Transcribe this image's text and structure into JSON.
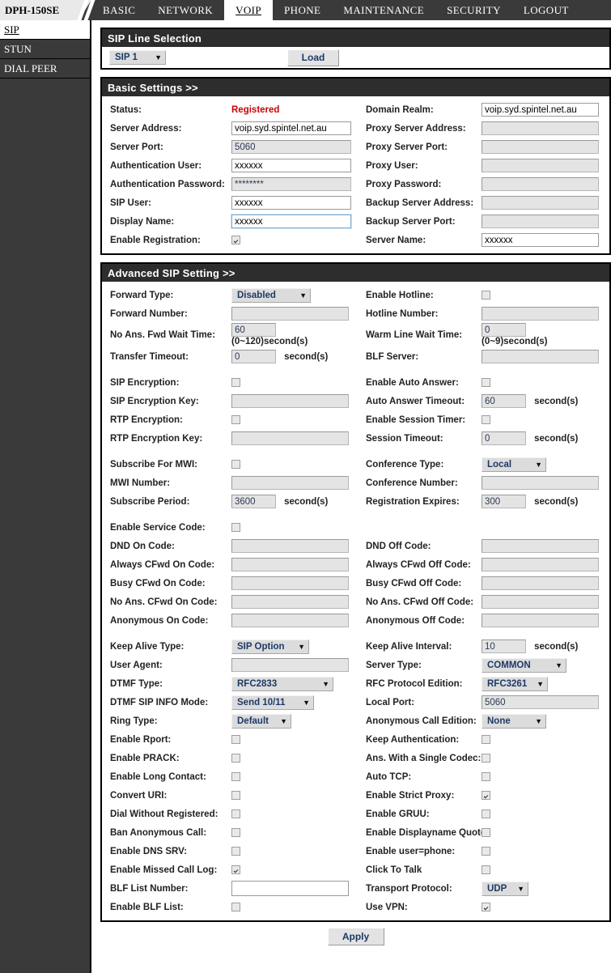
{
  "device": {
    "model": "DPH-150SE"
  },
  "nav": {
    "tabs": [
      {
        "label": "BASIC",
        "active": false
      },
      {
        "label": "NETWORK",
        "active": false
      },
      {
        "label": "VOIP",
        "active": true
      },
      {
        "label": "PHONE",
        "active": false
      },
      {
        "label": "MAINTENANCE",
        "active": false
      },
      {
        "label": "SECURITY",
        "active": false
      },
      {
        "label": "LOGOUT",
        "active": false
      }
    ]
  },
  "sidebar": {
    "items": [
      {
        "label": "SIP",
        "active": true
      },
      {
        "label": "STUN",
        "active": false
      },
      {
        "label": "DIAL PEER",
        "active": false
      }
    ]
  },
  "line_selection": {
    "title": "SIP Line Selection",
    "line_value": "SIP 1",
    "load_label": "Load"
  },
  "basic": {
    "title": "Basic Settings >>",
    "status_label": "Status:",
    "status_value": "Registered",
    "status_color": "#cc0000",
    "domain_realm_label": "Domain Realm:",
    "domain_realm_value": "voip.syd.spintel.net.au",
    "server_address_label": "Server Address:",
    "server_address_value": "voip.syd.spintel.net.au",
    "proxy_server_address_label": "Proxy Server Address:",
    "proxy_server_address_value": "",
    "server_port_label": "Server Port:",
    "server_port_value": "5060",
    "proxy_server_port_label": "Proxy Server Port:",
    "proxy_server_port_value": "",
    "auth_user_label": "Authentication User:",
    "auth_user_value": "xxxxxx",
    "proxy_user_label": "Proxy User:",
    "proxy_user_value": "",
    "auth_password_label": "Authentication Password:",
    "auth_password_value": "********",
    "proxy_password_label": "Proxy Password:",
    "proxy_password_value": "",
    "sip_user_label": "SIP User:",
    "sip_user_value": "xxxxxx",
    "backup_server_address_label": "Backup Server Address:",
    "backup_server_address_value": "",
    "display_name_label": "Display Name:",
    "display_name_value": "xxxxxx",
    "backup_server_port_label": "Backup Server Port:",
    "backup_server_port_value": "",
    "enable_registration_label": "Enable Registration:",
    "enable_registration_checked": true,
    "server_name_label": "Server Name:",
    "server_name_value": "xxxxxx"
  },
  "advanced": {
    "title": "Advanced SIP Setting >>",
    "forward_type_label": "Forward Type:",
    "forward_type_value": "Disabled",
    "enable_hotline_label": "Enable Hotline:",
    "enable_hotline_checked": false,
    "forward_number_label": "Forward Number:",
    "forward_number_value": "",
    "hotline_number_label": "Hotline Number:",
    "hotline_number_value": "",
    "no_ans_fwd_wait_label": "No Ans. Fwd Wait Time:",
    "no_ans_fwd_wait_value": "60",
    "no_ans_fwd_wait_hint": "(0~120)second(s)",
    "warm_line_wait_label": "Warm Line Wait Time:",
    "warm_line_wait_value": "0",
    "warm_line_wait_hint": "(0~9)second(s)",
    "transfer_timeout_label": "Transfer Timeout:",
    "transfer_timeout_value": "0",
    "transfer_timeout_unit": "second(s)",
    "blf_server_label": "BLF Server:",
    "blf_server_value": "",
    "sip_encryption_label": "SIP Encryption:",
    "sip_encryption_checked": false,
    "enable_auto_answer_label": "Enable Auto Answer:",
    "enable_auto_answer_checked": false,
    "sip_encryption_key_label": "SIP Encryption Key:",
    "sip_encryption_key_value": "",
    "auto_answer_timeout_label": "Auto Answer Timeout:",
    "auto_answer_timeout_value": "60",
    "auto_answer_timeout_unit": "second(s)",
    "rtp_encryption_label": "RTP Encryption:",
    "rtp_encryption_checked": false,
    "enable_session_timer_label": "Enable Session Timer:",
    "enable_session_timer_checked": false,
    "rtp_encryption_key_label": "RTP Encryption Key:",
    "rtp_encryption_key_value": "",
    "session_timeout_label": "Session Timeout:",
    "session_timeout_value": "0",
    "session_timeout_unit": "second(s)",
    "subscribe_mwi_label": "Subscribe For MWI:",
    "subscribe_mwi_checked": false,
    "conference_type_label": "Conference Type:",
    "conference_type_value": "Local",
    "mwi_number_label": "MWI Number:",
    "mwi_number_value": "",
    "conference_number_label": "Conference Number:",
    "conference_number_value": "",
    "subscribe_period_label": "Subscribe Period:",
    "subscribe_period_value": "3600",
    "subscribe_period_unit": "second(s)",
    "registration_expires_label": "Registration Expires:",
    "registration_expires_value": "300",
    "registration_expires_unit": "second(s)",
    "enable_service_code_label": "Enable Service Code:",
    "enable_service_code_checked": false,
    "dnd_on_label": "DND On Code:",
    "dnd_on_value": "",
    "dnd_off_label": "DND Off Code:",
    "dnd_off_value": "",
    "always_cfwd_on_label": "Always CFwd On Code:",
    "always_cfwd_on_value": "",
    "always_cfwd_off_label": "Always CFwd Off Code:",
    "always_cfwd_off_value": "",
    "busy_cfwd_on_label": "Busy CFwd On Code:",
    "busy_cfwd_on_value": "",
    "busy_cfwd_off_label": "Busy CFwd Off Code:",
    "busy_cfwd_off_value": "",
    "noans_cfwd_on_label": "No Ans. CFwd On Code:",
    "noans_cfwd_on_value": "",
    "noans_cfwd_off_label": "No Ans. CFwd Off Code:",
    "noans_cfwd_off_value": "",
    "anonymous_on_label": "Anonymous On Code:",
    "anonymous_on_value": "",
    "anonymous_off_label": "Anonymous Off Code:",
    "anonymous_off_value": "",
    "keep_alive_type_label": "Keep Alive Type:",
    "keep_alive_type_value": "SIP Option",
    "keep_alive_interval_label": "Keep Alive Interval:",
    "keep_alive_interval_value": "10",
    "keep_alive_interval_unit": "second(s)",
    "user_agent_label": "User Agent:",
    "user_agent_value": "",
    "server_type_label": "Server Type:",
    "server_type_value": "COMMON",
    "dtmf_type_label": "DTMF Type:",
    "dtmf_type_value": "RFC2833",
    "rfc_protocol_edition_label": "RFC Protocol Edition:",
    "rfc_protocol_edition_value": "RFC3261",
    "dtmf_sip_info_mode_label": "DTMF SIP INFO Mode:",
    "dtmf_sip_info_mode_value": "Send 10/11",
    "local_port_label": "Local Port:",
    "local_port_value": "5060",
    "ring_type_label": "Ring Type:",
    "ring_type_value": "Default",
    "anonymous_call_edition_label": "Anonymous Call Edition:",
    "anonymous_call_edition_value": "None",
    "enable_rport_label": "Enable Rport:",
    "enable_rport_checked": false,
    "keep_authentication_label": "Keep Authentication:",
    "keep_authentication_checked": false,
    "enable_prack_label": "Enable PRACK:",
    "enable_prack_checked": false,
    "ans_single_codec_label": "Ans. With a Single Codec:",
    "ans_single_codec_checked": false,
    "enable_long_contact_label": "Enable Long Contact:",
    "enable_long_contact_checked": false,
    "auto_tcp_label": "Auto TCP:",
    "auto_tcp_checked": false,
    "convert_uri_label": "Convert URI:",
    "convert_uri_checked": false,
    "enable_strict_proxy_label": "Enable Strict Proxy:",
    "enable_strict_proxy_checked": true,
    "dial_without_registered_label": "Dial Without Registered:",
    "dial_without_registered_checked": false,
    "enable_gruu_label": "Enable GRUU:",
    "enable_gruu_checked": false,
    "ban_anonymous_call_label": "Ban Anonymous Call:",
    "ban_anonymous_call_checked": false,
    "enable_displayname_quote_label": "Enable Displayname Quote:",
    "enable_displayname_quote_checked": false,
    "enable_dns_srv_label": "Enable DNS SRV:",
    "enable_dns_srv_checked": false,
    "enable_user_phone_label": "Enable user=phone:",
    "enable_user_phone_checked": false,
    "enable_missed_call_log_label": "Enable Missed Call Log:",
    "enable_missed_call_log_checked": true,
    "click_to_talk_label": "Click To Talk",
    "click_to_talk_checked": false,
    "blf_list_number_label": "BLF List Number:",
    "blf_list_number_value": "",
    "transport_protocol_label": "Transport Protocol:",
    "transport_protocol_value": "UDP",
    "enable_blf_list_label": "Enable BLF List:",
    "enable_blf_list_checked": false,
    "use_vpn_label": "Use VPN:",
    "use_vpn_checked": true
  },
  "footer": {
    "apply_label": "Apply"
  }
}
